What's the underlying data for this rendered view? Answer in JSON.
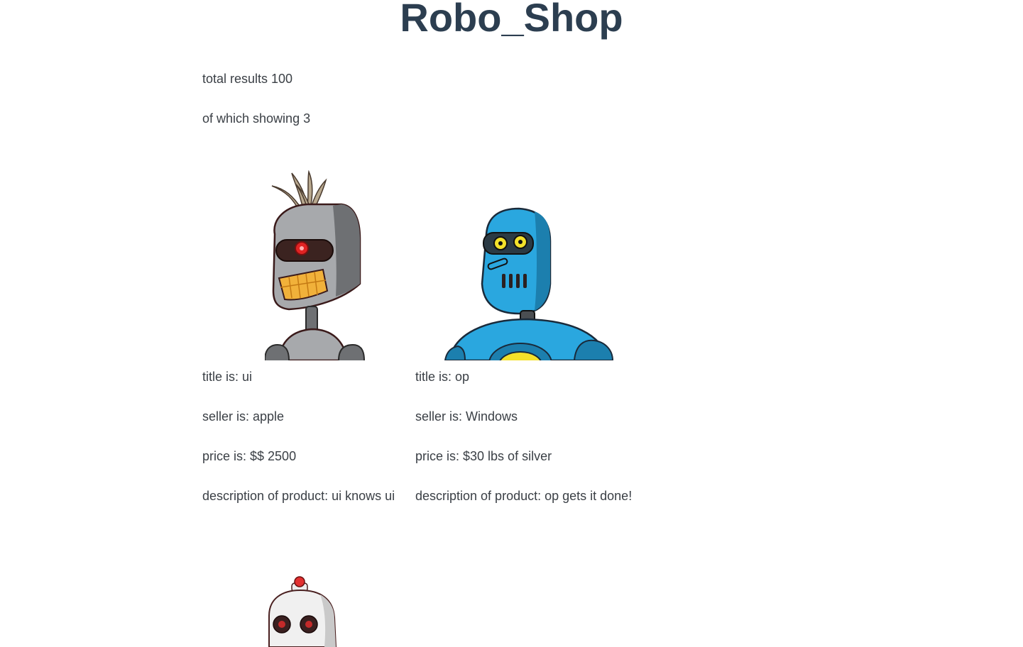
{
  "header": {
    "title": "Robo_Shop"
  },
  "summary": {
    "total_label": "total results 100",
    "showing_label": "of which showing 3"
  },
  "products": [
    {
      "image_icon": "gray-robot-icon",
      "title": "title is: ui",
      "seller": "seller is: apple",
      "price": "price is: $$ 2500",
      "description": "description of product: ui knows ui"
    },
    {
      "image_icon": "blue-robot-icon",
      "title": "title is: op",
      "seller": "seller is: Windows",
      "price": "price is: $30 lbs of silver",
      "description": "description of product: op gets it done!"
    },
    {
      "image_icon": "white-robot-icon"
    }
  ]
}
